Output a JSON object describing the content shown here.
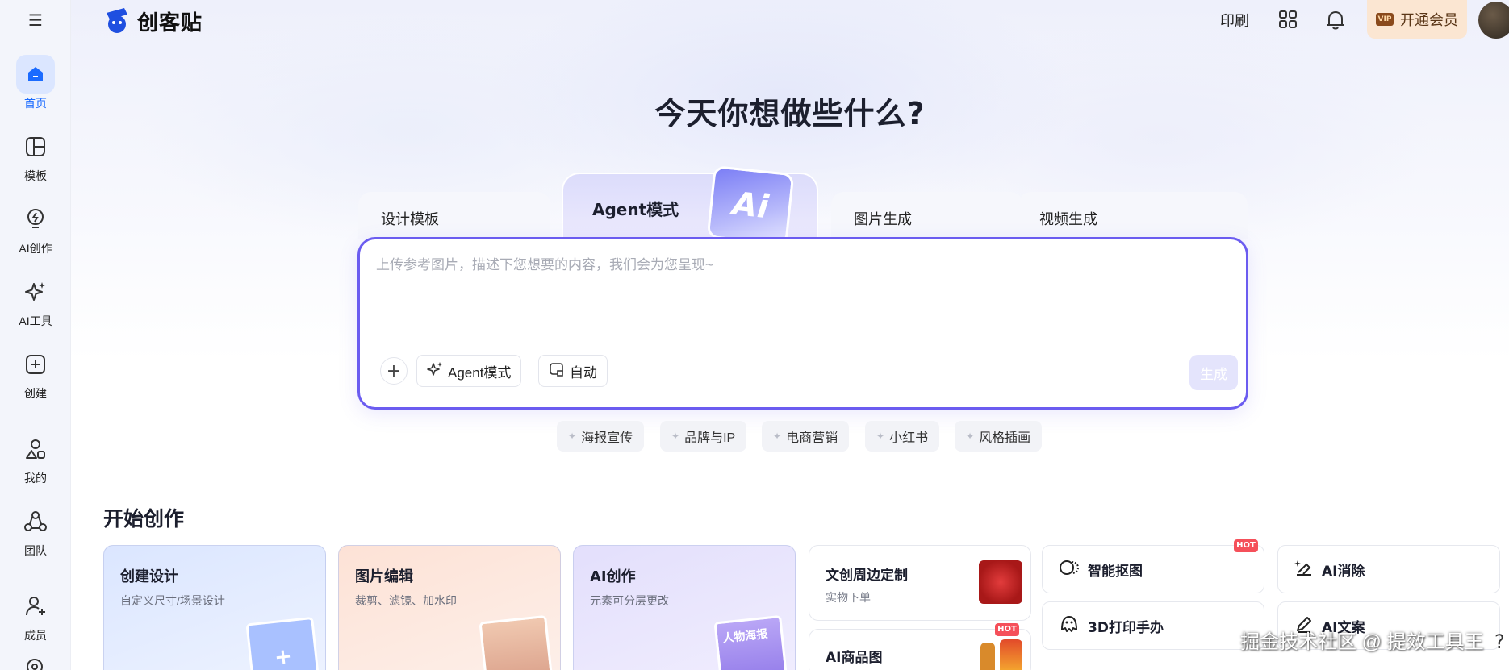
{
  "app": {
    "logo_text": "创客贴"
  },
  "sidebar": {
    "items": [
      {
        "label": "首页",
        "icon": "home-icon",
        "active": true
      },
      {
        "label": "模板",
        "icon": "template-icon"
      },
      {
        "label": "AI创作",
        "icon": "bulb-icon"
      },
      {
        "label": "AI工具",
        "icon": "sparkle-icon"
      },
      {
        "label": "创建",
        "icon": "plus-square-icon"
      },
      {
        "label": "我的",
        "icon": "user-shapes-icon"
      },
      {
        "label": "团队",
        "icon": "team-icon"
      },
      {
        "label": "成员",
        "icon": "add-user-icon"
      }
    ]
  },
  "header": {
    "print": "印刷",
    "vip_badge": "VIP",
    "vip_label": "开通会员"
  },
  "hero": {
    "title": "今天你想做些什么?"
  },
  "tabs": {
    "design": "设计模板",
    "agent": "Agent模式",
    "image": "图片生成",
    "video": "视频生成",
    "agent_card_text": "Ai"
  },
  "prompt": {
    "placeholder": "上传参考图片，描述下您想要的内容，我们会为您呈现~",
    "plus": "+",
    "agent_chip": "Agent模式",
    "auto_chip": "自动",
    "generate": "生成"
  },
  "quick_tags": [
    "海报宣传",
    "品牌与IP",
    "电商营销",
    "小红书",
    "风格插画"
  ],
  "section": {
    "title": "开始创作"
  },
  "feature_cards": [
    {
      "title": "创建设计",
      "sub": "自定义尺寸/场景设计"
    },
    {
      "title": "图片编辑",
      "sub": "裁剪、滤镜、加水印"
    },
    {
      "title": "AI创作",
      "sub": "元素可分层更改",
      "badge": "人物海报"
    }
  ],
  "mid_cards": [
    {
      "title": "文创周边定制",
      "sub": "实物下单"
    },
    {
      "title": "AI商品图",
      "hot": "HOT"
    }
  ],
  "tools": [
    {
      "label": "智能抠图",
      "icon": "cutout-icon",
      "hot": "HOT"
    },
    {
      "label": "AI消除",
      "icon": "eraser-icon"
    },
    {
      "label": "3D打印手办",
      "icon": "figure-icon"
    },
    {
      "label": "AI文案",
      "icon": "pen-icon"
    }
  ],
  "design_card_plus": "+",
  "watermark": "掘金技术社区 @ 提效工具王",
  "help": "?",
  "colors": {
    "accent": "#6b5cf0",
    "active_blue": "#1b6bff",
    "vip_bg": "#fbe6d2",
    "hot": "#f5505a"
  }
}
